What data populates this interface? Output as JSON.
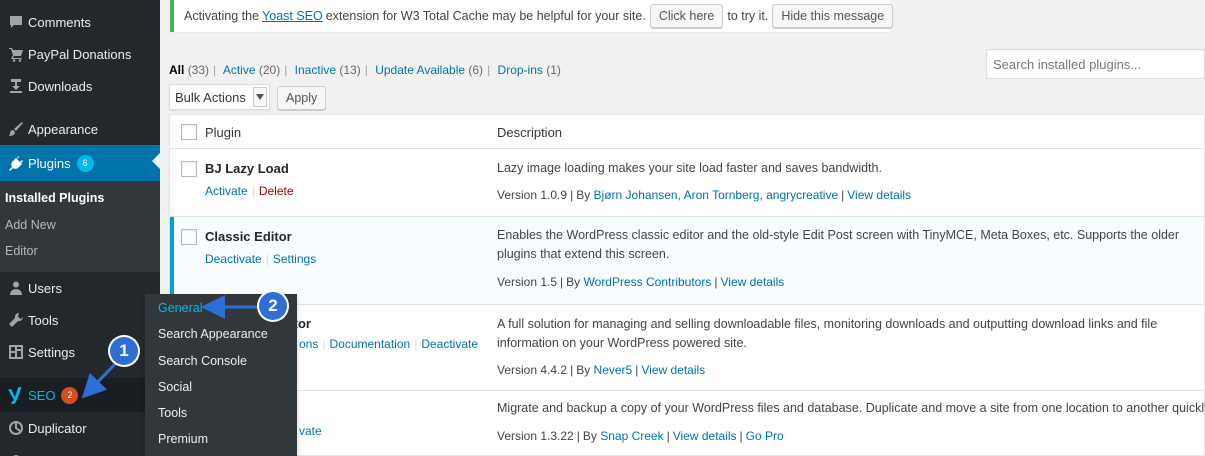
{
  "sidebar": {
    "items": [
      {
        "label": "Comments",
        "icon": "comment-icon"
      },
      {
        "label": "PayPal Donations",
        "icon": "cart-icon"
      },
      {
        "label": "Downloads",
        "icon": "download-icon"
      },
      {
        "label": "Appearance",
        "icon": "paintbrush-icon"
      },
      {
        "label": "Plugins",
        "icon": "plug-icon",
        "badge": "6"
      },
      {
        "label": "Users",
        "icon": "users-icon"
      },
      {
        "label": "Tools",
        "icon": "wrench-icon"
      },
      {
        "label": "Settings",
        "icon": "settings-icon"
      },
      {
        "label": "SEO",
        "icon": "yoast-icon",
        "badge": "2"
      },
      {
        "label": "Duplicator",
        "icon": "duplicator-icon"
      }
    ],
    "plugins_submenu": [
      "Installed Plugins",
      "Add New",
      "Editor"
    ]
  },
  "seo_flyout": [
    "General",
    "Search Appearance",
    "Search Console",
    "Social",
    "Tools",
    "Premium"
  ],
  "notice": {
    "text_before": "Activating the",
    "link": "Yoast SEO",
    "text_after": "extension for W3 Total Cache may be helpful for your site.",
    "button1": "Click here",
    "text_mid": "to try it.",
    "button2": "Hide this message"
  },
  "filters": {
    "all": "All",
    "all_count": "(33)",
    "active": "Active",
    "active_count": "(20)",
    "inactive": "Inactive",
    "inactive_count": "(13)",
    "update": "Update Available",
    "update_count": "(6)",
    "dropins": "Drop-ins",
    "dropins_count": "(1)"
  },
  "search": {
    "placeholder": "Search installed plugins..."
  },
  "bulk": {
    "selected": "Bulk Actions",
    "apply": "Apply"
  },
  "table": {
    "col_plugin": "Plugin",
    "col_description": "Description",
    "rows": [
      {
        "name": "BJ Lazy Load",
        "actions": [
          "Activate",
          "Delete"
        ],
        "description": "Lazy image loading makes your site load faster and saves bandwidth.",
        "version": "Version 1.0.9",
        "by": "By",
        "authors": "Bjørn Johansen, Aron Tornberg, angrycreative",
        "details": "View details"
      },
      {
        "name": "Classic Editor",
        "actions": [
          "Deactivate",
          "Settings"
        ],
        "description": "Enables the WordPress classic editor and the old-style Edit Post screen with TinyMCE, Meta Boxes, etc. Supports the older plugins that extend this screen.",
        "version": "Version 1.5",
        "by": "By",
        "authors": "WordPress Contributors",
        "details": "View details"
      },
      {
        "name": "itor",
        "actions": [
          "ons",
          "Documentation",
          "Deactivate"
        ],
        "description": "A full solution for managing and selling downloadable files, monitoring downloads and outputting download links and file information on your WordPress powered site.",
        "version": "Version 4.4.2",
        "by": "By",
        "authors": "Never5",
        "details": "View details"
      },
      {
        "name": "",
        "actions": [
          "vate"
        ],
        "description": "Migrate and backup a copy of your WordPress files and database. Duplicate and move a site from one location to another quickly.",
        "version": "Version 1.3.22",
        "by": "By",
        "authors": "Snap Creek",
        "details": "View details",
        "extra": "Go Pro"
      }
    ]
  },
  "annotations": {
    "marker1": "1",
    "marker2": "2",
    "color": "#2e6fd6"
  }
}
